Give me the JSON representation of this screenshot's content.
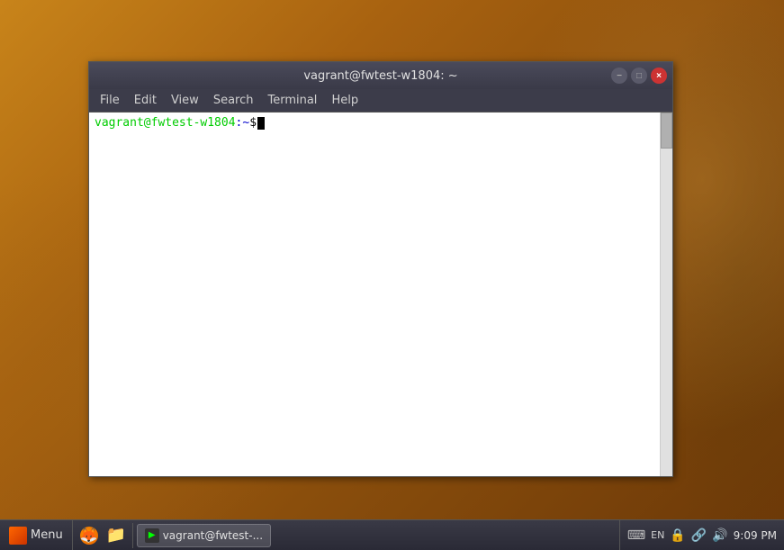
{
  "desktop": {
    "background_color": "#b8741a"
  },
  "terminal": {
    "title": "vagrant@fwtest-w1804: ~",
    "title_bar": {
      "label": "vagrant@fwtest-w1804: ~",
      "minimize_label": "−",
      "maximize_label": "□",
      "close_label": "×"
    },
    "menu_bar": {
      "items": [
        "File",
        "Edit",
        "View",
        "Search",
        "Terminal",
        "Help"
      ]
    },
    "prompt": {
      "user_host": "vagrant@fwtest-w1804",
      "separator": ":",
      "path": "~",
      "dollar": "$"
    }
  },
  "taskbar": {
    "start_label": "Menu",
    "task_item_label": "vagrant@fwtest-...",
    "tray": {
      "keyboard": "EN",
      "time": "9:09 PM"
    }
  }
}
